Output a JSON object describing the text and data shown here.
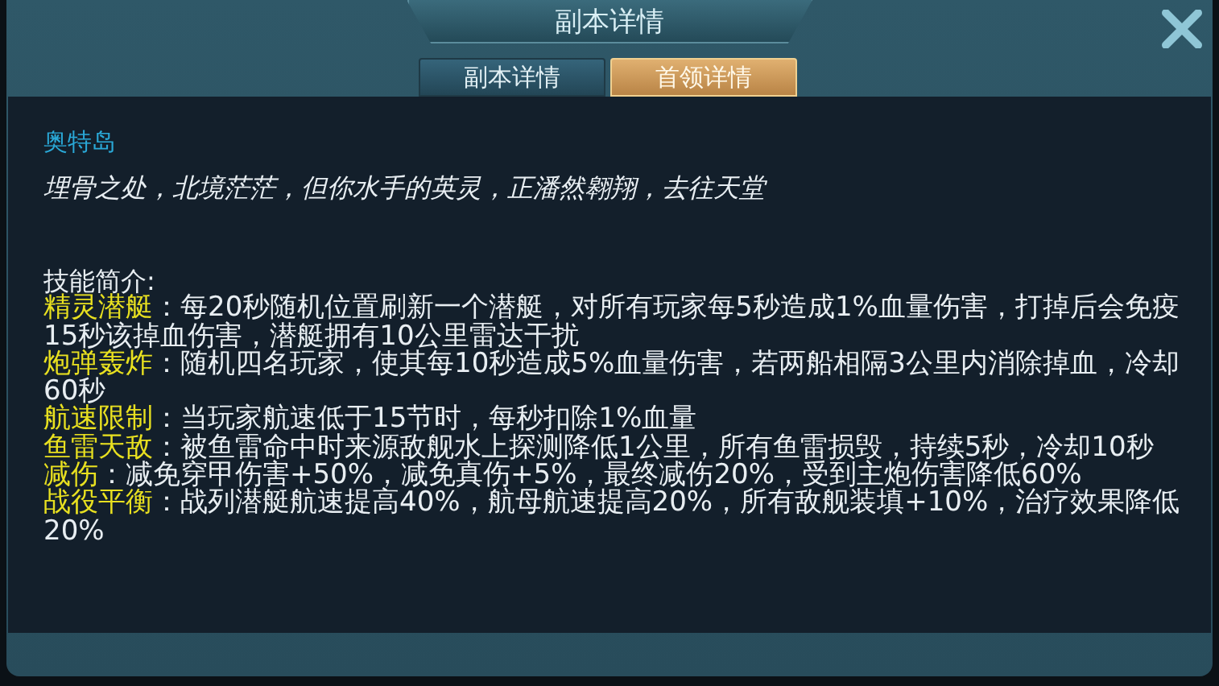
{
  "window": {
    "title": "副本详情"
  },
  "tabs": [
    {
      "label": "副本详情",
      "selected": false
    },
    {
      "label": "首领详情",
      "selected": true
    }
  ],
  "content": {
    "heading": "奥特岛",
    "quote": "埋骨之处，北境茫茫，但你水手的英灵，正潘然翱翔，去往天堂",
    "skills_label": "技能简介:",
    "skills": [
      {
        "name": "精灵潜艇",
        "text": "：每20秒随机位置刷新一个潜艇，对所有玩家每5秒造成1%血量伤害，打掉后会免疫15秒该掉血伤害，潜艇拥有10公里雷达干扰"
      },
      {
        "name": "炮弹轰炸",
        "text": "：随机四名玩家，使其每10秒造成5%血量伤害，若两船相隔3公里内消除掉血，冷却60秒"
      },
      {
        "name": "航速限制",
        "text": "：当玩家航速低于15节时，每秒扣除1%血量"
      },
      {
        "name": "鱼雷天敌",
        "text": "：被鱼雷命中时来源敌舰水上探测降低1公里，所有鱼雷损毁，持续5秒，冷却10秒"
      },
      {
        "name": "减伤",
        "text": "：减免穿甲伤害+50%，减免真伤+5%，最终减伤20%，受到主炮伤害降低60%"
      },
      {
        "name": "战役平衡",
        "text": "：战列潜艇航速提高40%，航母航速提高20%，所有敌舰装填+10%，治疗效果降低20%"
      }
    ]
  }
}
